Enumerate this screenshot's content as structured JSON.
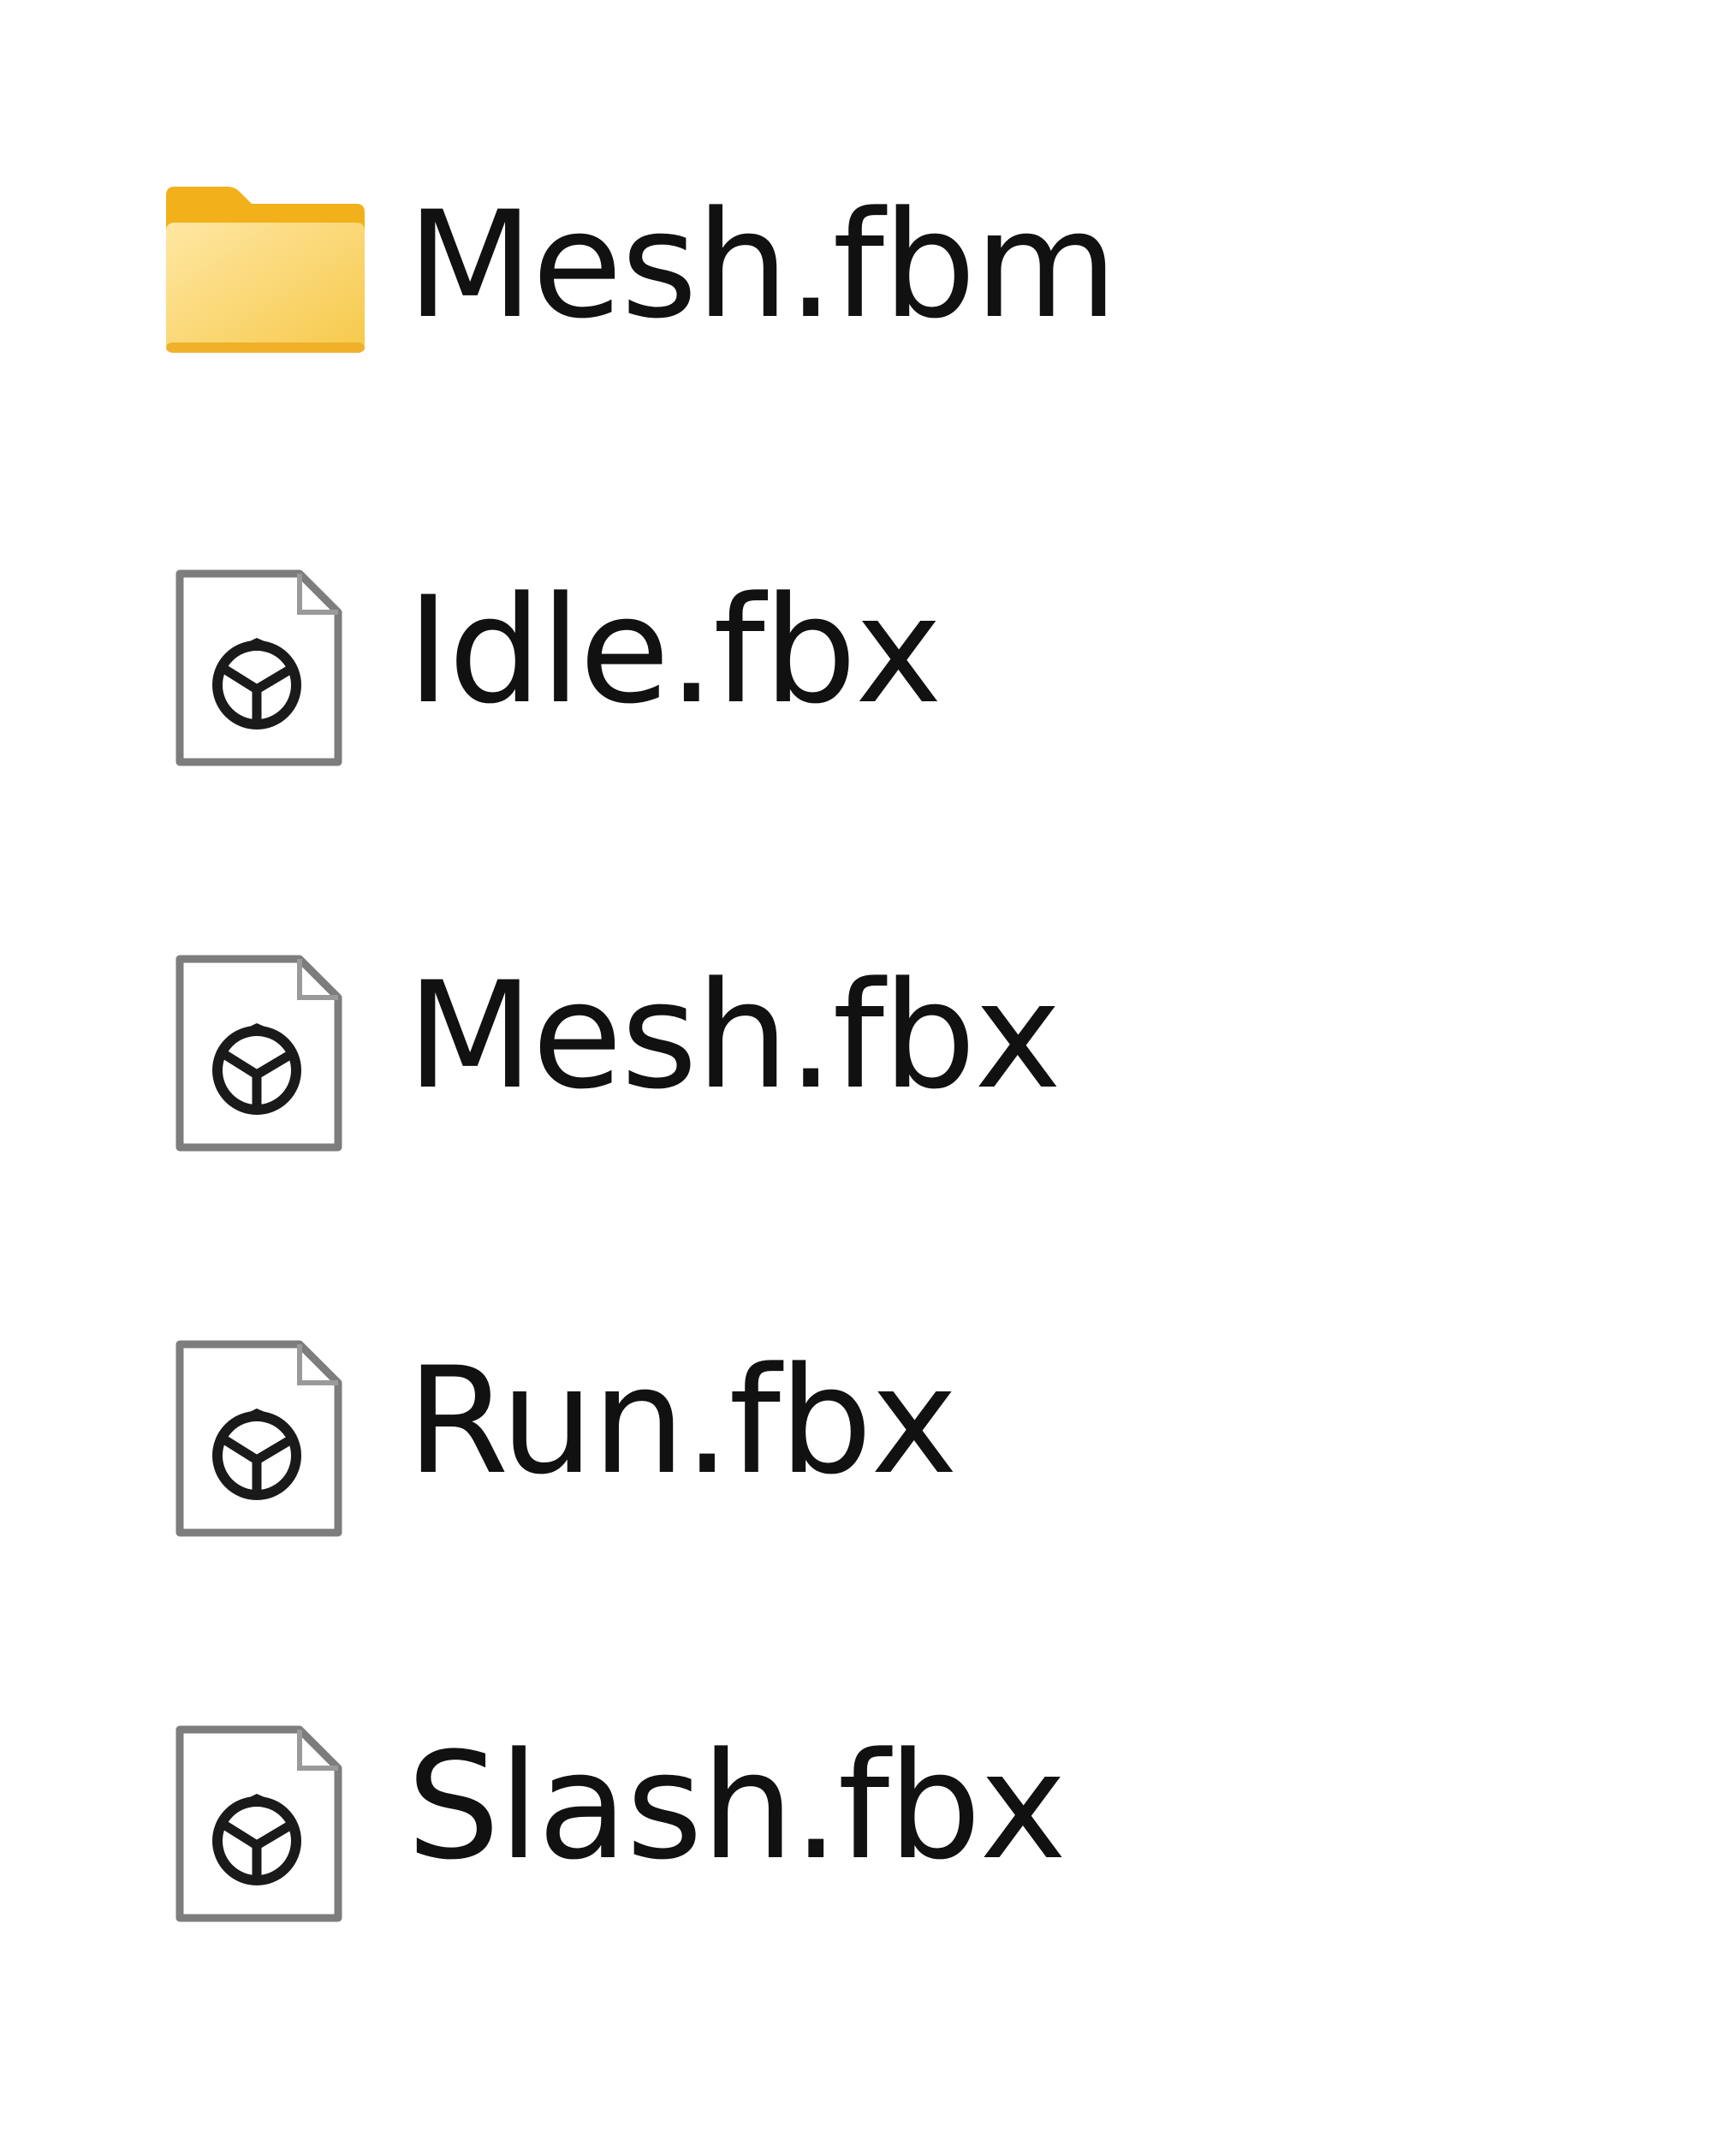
{
  "files": [
    {
      "name": "Mesh.fbm",
      "type": "folder",
      "icon": "folder-icon"
    },
    {
      "name": "Idle.fbx",
      "type": "file",
      "icon": "fbx-file-icon"
    },
    {
      "name": "Mesh.fbx",
      "type": "file",
      "icon": "fbx-file-icon"
    },
    {
      "name": "Run.fbx",
      "type": "file",
      "icon": "fbx-file-icon"
    },
    {
      "name": "Slash.fbx",
      "type": "file",
      "icon": "fbx-file-icon"
    }
  ],
  "colors": {
    "folder_light": "#FDDB7A",
    "folder_dark": "#F2B11B",
    "file_outline": "#7d7d7d",
    "text": "#111111"
  }
}
